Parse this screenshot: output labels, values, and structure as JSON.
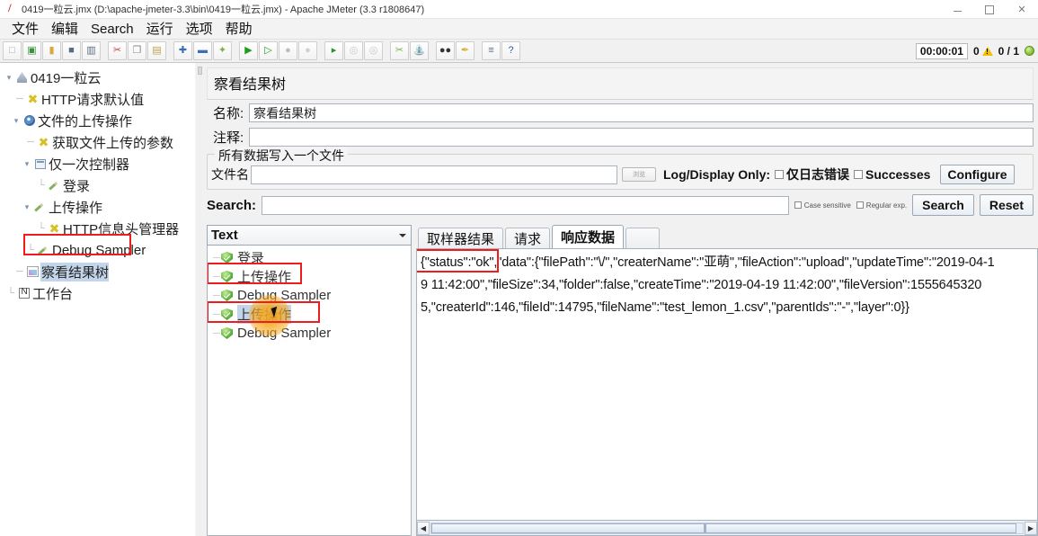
{
  "window": {
    "title": "0419一粒云.jmx (D:\\apache-jmeter-3.3\\bin\\0419一粒云.jmx) - Apache JMeter (3.3 r1808647)",
    "app_icon": "jmeter-icon",
    "minimize": "minimize-icon",
    "maximize": "maximize-icon",
    "close": "close-icon"
  },
  "menubar": {
    "items": [
      {
        "label": "文件",
        "name": "menu-file"
      },
      {
        "label": "编辑",
        "name": "menu-edit"
      },
      {
        "label": "Search",
        "name": "menu-search"
      },
      {
        "label": "运行",
        "name": "menu-run"
      },
      {
        "label": "选项",
        "name": "menu-options"
      },
      {
        "label": "帮助",
        "name": "menu-help"
      }
    ]
  },
  "toolbar": {
    "buttons": [
      {
        "name": "new-icon",
        "glyph": "□"
      },
      {
        "name": "templates-icon",
        "glyph": "▣"
      },
      {
        "name": "open-icon",
        "glyph": "▰"
      },
      {
        "name": "save-icon",
        "glyph": "■"
      },
      {
        "name": "save-as-icon",
        "glyph": "▥"
      },
      {
        "name": "cut-icon",
        "glyph": "✂"
      },
      {
        "name": "copy-icon",
        "glyph": "❐"
      },
      {
        "name": "paste-icon",
        "glyph": "▤"
      },
      {
        "name": "expand-icon",
        "glyph": "✚"
      },
      {
        "name": "collapse-icon",
        "glyph": "➖"
      },
      {
        "name": "toggle-icon",
        "glyph": "✦"
      },
      {
        "name": "start-icon",
        "glyph": "▶"
      },
      {
        "name": "start-no-pause-icon",
        "glyph": "▷"
      },
      {
        "name": "stop-icon",
        "glyph": "●"
      },
      {
        "name": "shutdown-icon",
        "glyph": "○"
      },
      {
        "name": "start-remote-icon",
        "glyph": "▸"
      },
      {
        "name": "stop-remote-icon",
        "glyph": "◌"
      },
      {
        "name": "shutdown-remote-icon",
        "glyph": "◌"
      },
      {
        "name": "clear-icon",
        "glyph": "☑"
      },
      {
        "name": "clear-all-icon",
        "glyph": "☒"
      },
      {
        "name": "search-icon",
        "glyph": "●●"
      },
      {
        "name": "search-reset-icon",
        "glyph": "✎"
      },
      {
        "name": "function-helper-icon",
        "glyph": "≡"
      },
      {
        "name": "help-icon",
        "glyph": "?"
      }
    ],
    "status": {
      "elapsed": "00:00:01",
      "warning_count": "0",
      "warning_icon": "warning-triangle-icon",
      "threads": "0 / 1",
      "indicator_icon": "thread-indicator-icon"
    }
  },
  "tree": {
    "nodes": [
      {
        "label": "0419一粒云",
        "name": "tree-node-test-plan",
        "icon": "thread-group-icon",
        "depth": 0,
        "expander": "▾",
        "selected": false
      },
      {
        "label": "HTTP请求默认值",
        "name": "tree-node-http-defaults",
        "icon": "config-x-icon",
        "depth": 1,
        "expander": "",
        "selected": false
      },
      {
        "label": "文件的上传操作",
        "name": "tree-node-thread-group",
        "icon": "gear-icon",
        "depth": 1,
        "expander": "▾",
        "selected": false
      },
      {
        "label": "获取文件上传的参数",
        "name": "tree-node-get-params",
        "icon": "config-x-icon",
        "depth": 2,
        "expander": "",
        "selected": false
      },
      {
        "label": "仅一次控制器",
        "name": "tree-node-once-only-controller",
        "icon": "controller-icon",
        "depth": 2,
        "expander": "▾",
        "selected": false
      },
      {
        "label": "登录",
        "name": "tree-node-login-sampler",
        "icon": "sampler-icon",
        "depth": 3,
        "expander": "",
        "selected": false
      },
      {
        "label": "上传操作",
        "name": "tree-node-upload-sampler",
        "icon": "sampler-icon",
        "depth": 2,
        "expander": "▾",
        "selected": false
      },
      {
        "label": "HTTP信息头管理器",
        "name": "tree-node-header-manager",
        "icon": "config-x-icon",
        "depth": 3,
        "expander": "",
        "selected": false
      },
      {
        "label": "Debug Sampler",
        "name": "tree-node-debug-sampler",
        "icon": "sampler-icon",
        "depth": 2,
        "expander": "",
        "selected": false
      },
      {
        "label": "察看结果树",
        "name": "tree-node-view-results-tree",
        "icon": "listener-graph-icon",
        "depth": 1,
        "expander": "",
        "selected": true
      },
      {
        "label": "工作台",
        "name": "tree-node-workbench",
        "icon": "workbench-icon",
        "depth": 0,
        "expander": "",
        "selected": false
      }
    ]
  },
  "panel": {
    "title": "察看结果树",
    "name_label": "名称:",
    "name_value": "察看结果树",
    "comment_label": "注释:",
    "comment_value": "",
    "group_title": "所有数据写入一个文件",
    "filename_label": "文件名",
    "filename_value": "",
    "browse_label": "浏览",
    "log_display_label": "Log/Display Only:",
    "errors_only_label": "仅日志错误",
    "successes_label": "Successes",
    "configure_label": "Configure"
  },
  "search": {
    "label": "Search:",
    "value": "",
    "case_sensitive_label": "Case sensitive",
    "regular_exp_label": "Regular exp.",
    "search_button": "Search",
    "reset_button": "Reset"
  },
  "results": {
    "render_selector": "Text",
    "items": [
      {
        "label": "登录",
        "name": "result-item-login",
        "selected": false
      },
      {
        "label": "上传操作",
        "name": "result-item-upload-1",
        "selected": false
      },
      {
        "label": "Debug Sampler",
        "name": "result-item-debug-1",
        "selected": false
      },
      {
        "label": "上传操作",
        "name": "result-item-upload-2",
        "selected": true
      },
      {
        "label": "Debug Sampler",
        "name": "result-item-debug-2",
        "selected": false
      }
    ],
    "tabs": [
      {
        "label": "取样器结果",
        "name": "tab-sampler-result",
        "active": false
      },
      {
        "label": "请求",
        "name": "tab-request",
        "active": false
      },
      {
        "label": "响应数据",
        "name": "tab-response-data",
        "active": true
      }
    ],
    "response_lines": [
      "{\"status\":\"ok\",\"data\":{\"filePath\":\"\\/\",\"createrName\":\"亚萌\",\"fileAction\":\"upload\",\"updateTime\":\"2019-04-1",
      "9 11:42:00\",\"fileSize\":34,\"folder\":false,\"createTime\":\"2019-04-19 11:42:00\",\"fileVersion\":1555645320",
      "5,\"createrId\":146,\"fileId\":14795,\"fileName\":\"test_lemon_1.csv\",\"parentIds\":\"-\",\"layer\":0}}"
    ]
  },
  "colors": {
    "accent_red": "#ee1c1c",
    "selection_blue": "#c3d5ea",
    "click_orange": "#f7a81e",
    "panel_gray": "#f1f1f1"
  }
}
